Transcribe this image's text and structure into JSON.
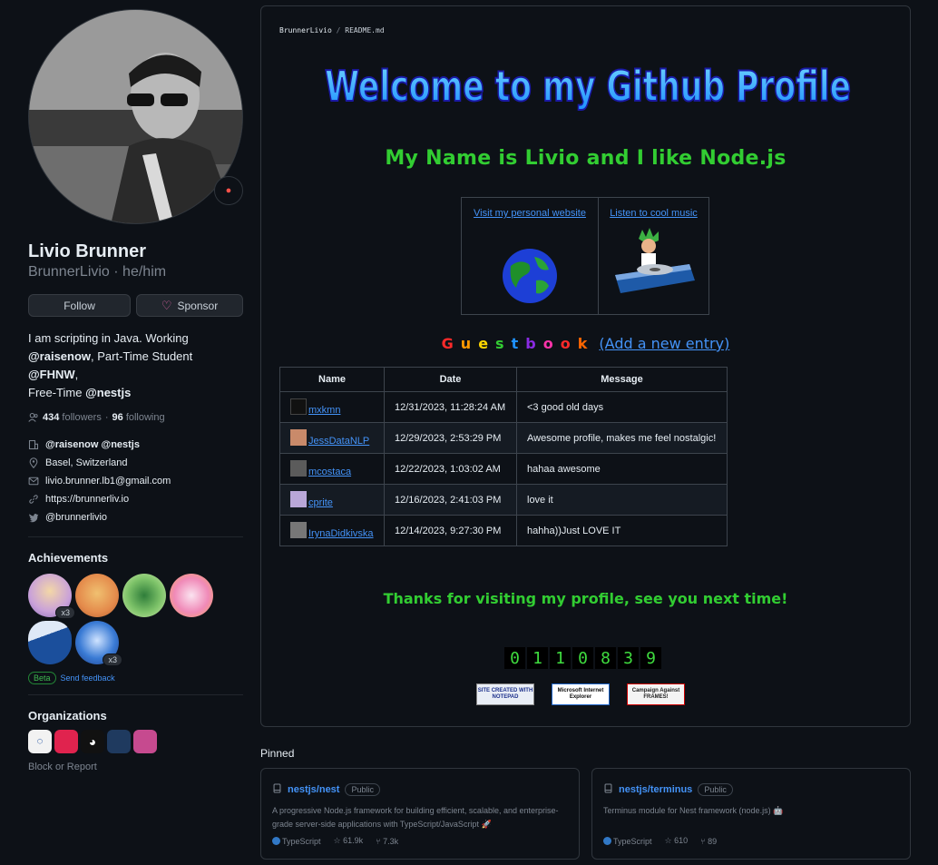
{
  "profile": {
    "name": "Livio Brunner",
    "login": "BrunnerLivio · he/him",
    "follow_label": "Follow",
    "sponsor_label": "Sponsor",
    "bio_1": "I am scripting in Java. Working",
    "bio_2a": "@raisenow",
    "bio_2b": ", Part-Time Student ",
    "bio_2c": "@FHNW",
    "bio_2d": ",",
    "bio_3a": "Free-Time ",
    "bio_3b": "@nestjs",
    "followers_count": "434",
    "followers_label": "followers",
    "following_count": "96",
    "following_label": "following",
    "org_line": "@raisenow @nestjs",
    "location": "Basel, Switzerland",
    "email": "livio.brunner.lb1@gmail.com",
    "website": "https://brunnerliv.io",
    "twitter": "@brunnerlivio"
  },
  "achievements": {
    "title": "Achievements",
    "items": [
      {
        "icon": "pull-shark-achievement-icon",
        "count": "x3"
      },
      {
        "icon": "yolo-cowboy-achievement-icon",
        "count": ""
      },
      {
        "icon": "pair-extraordinaire-achievement-icon",
        "count": ""
      },
      {
        "icon": "yolo-achievement-icon",
        "count": ""
      },
      {
        "icon": "arctic-code-vault-achievement-icon",
        "count": ""
      },
      {
        "icon": "shark-achievement-icon",
        "count": "x3"
      }
    ],
    "beta_label": "Beta",
    "feedback_label": "Send feedback"
  },
  "organizations": {
    "title": "Organizations",
    "block_label": "Block or Report"
  },
  "readme": {
    "crumb_user": "BrunnerLivio",
    "crumb_sep": "/",
    "crumb_file": "README.md",
    "welcome": "Welcome to my Github Profile",
    "tagline": "My Name is Livio and I like Node.js",
    "visit_link": "Visit my personal website",
    "music_link": "Listen to cool music",
    "guestbook_word": "Guestbook",
    "add_entry": "(Add a new entry)",
    "table_headers": [
      "Name",
      "Date",
      "Message"
    ],
    "entries": [
      {
        "user": "mxkmn",
        "date": "12/31/2023, 11:28:24 AM",
        "message": "<3 good old days"
      },
      {
        "user": "JessDataNLP",
        "date": "12/29/2023, 2:53:29 PM",
        "message": "Awesome profile, makes me feel nostalgic!"
      },
      {
        "user": "mcostaca",
        "date": "12/22/2023, 1:03:02 AM",
        "message": "hahaa awesome"
      },
      {
        "user": "cprite",
        "date": "12/16/2023, 2:41:03 PM",
        "message": "love it"
      },
      {
        "user": "IrynaDidkivska",
        "date": "12/14/2023, 9:27:30 PM",
        "message": "hahha))Just LOVE IT"
      }
    ],
    "thanks": "Thanks for visiting my profile, see you next time!",
    "counter_digits": [
      "0",
      "1",
      "1",
      "0",
      "8",
      "3",
      "9"
    ],
    "badge_notepad": "SITE CREATED WITH NOTEPAD",
    "badge_ie": "Microsoft Internet Explorer",
    "badge_frames": "Campaign Against FRAMES!"
  },
  "pinned": {
    "title": "Pinned",
    "repos": [
      {
        "name": "nestjs/nest",
        "visibility": "Public",
        "desc": "A progressive Node.js framework for building efficient, scalable, and enterprise-grade server-side applications with TypeScript/JavaScript 🚀",
        "language": "TypeScript",
        "stars": "61.9k",
        "forks": "7.3k"
      },
      {
        "name": "nestjs/terminus",
        "visibility": "Public",
        "desc": "Terminus module for Nest framework (node.js) 🤖",
        "language": "TypeScript",
        "stars": "610",
        "forks": "89"
      }
    ]
  },
  "colors": {
    "background": "#0d1117",
    "link": "#4493f8",
    "green_text": "#32cd32",
    "counter_green": "#3fdc3f"
  }
}
